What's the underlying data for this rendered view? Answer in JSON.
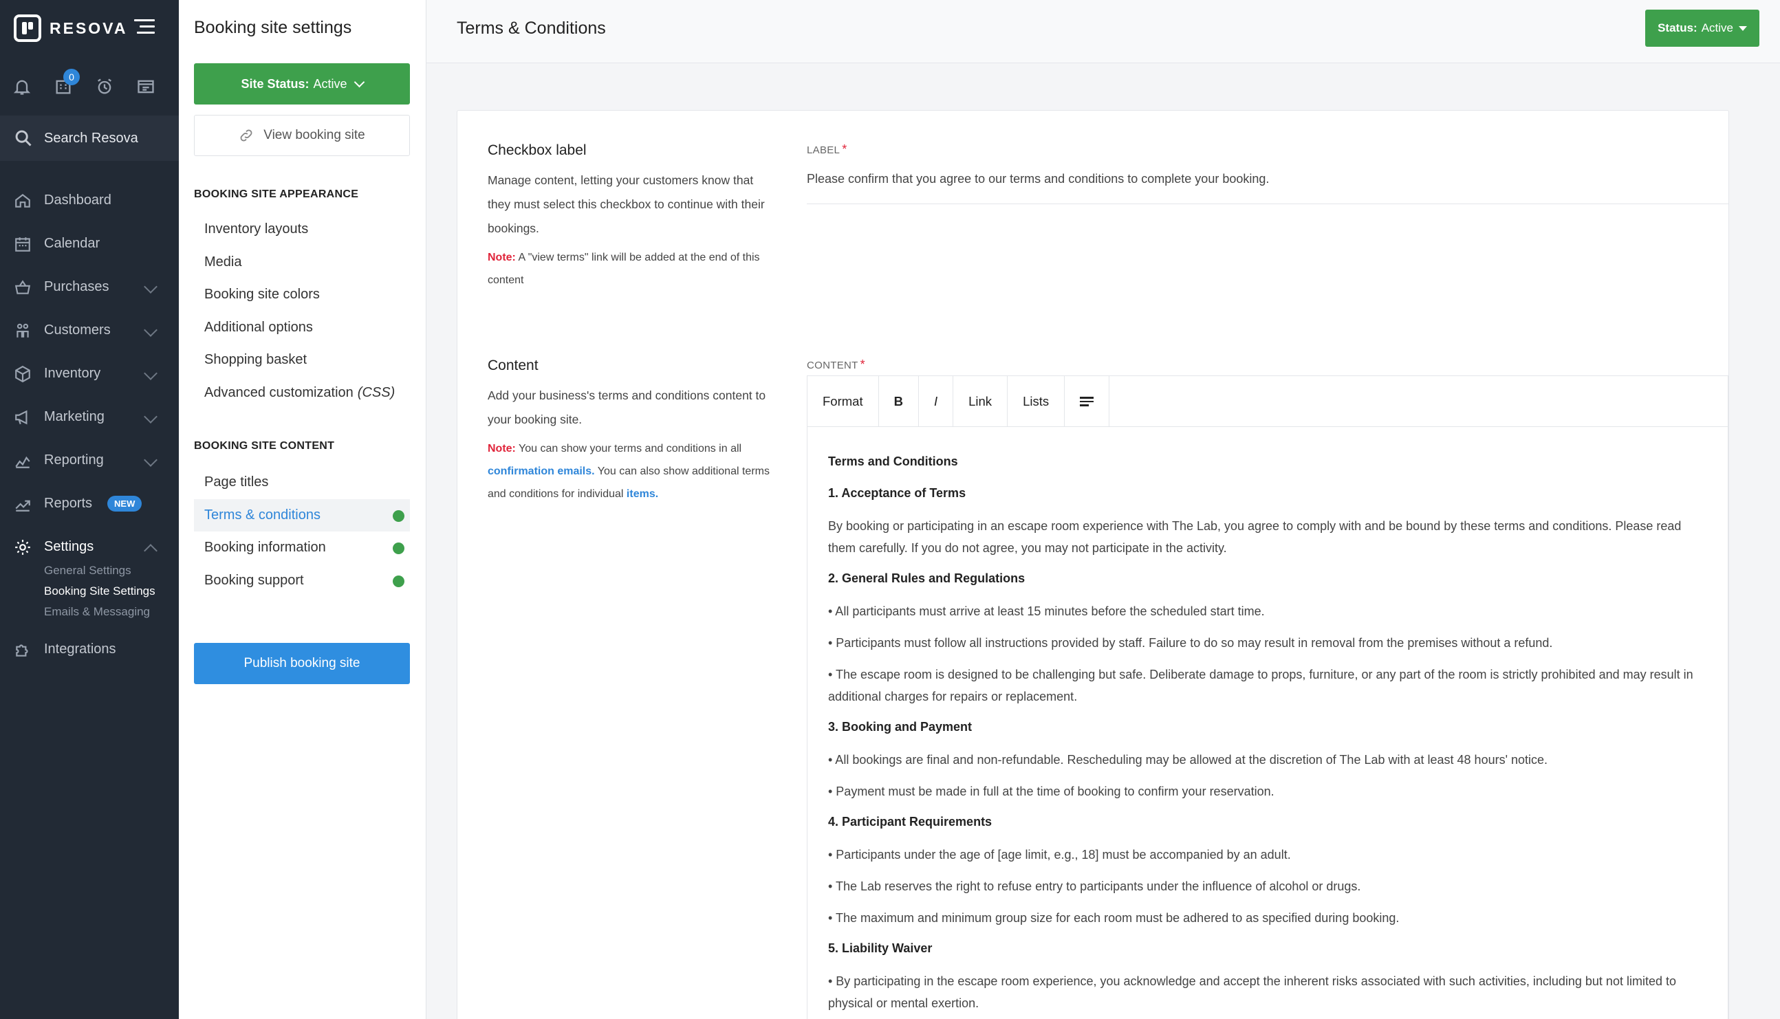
{
  "nav": {
    "brand": "RESOVA",
    "notification_count": "0",
    "search_label": "Search Resova",
    "items": [
      {
        "label": "Dashboard",
        "icon": "home-icon"
      },
      {
        "label": "Calendar",
        "icon": "calendar-icon"
      },
      {
        "label": "Purchases",
        "icon": "basket-icon"
      },
      {
        "label": "Customers",
        "icon": "customers-icon"
      },
      {
        "label": "Inventory",
        "icon": "box-icon"
      },
      {
        "label": "Marketing",
        "icon": "megaphone-icon"
      },
      {
        "label": "Reporting",
        "icon": "line-chart-icon"
      },
      {
        "label": "Reports",
        "icon": "trend-icon",
        "badge": "NEW"
      },
      {
        "label": "Settings",
        "icon": "gear-icon"
      },
      {
        "label": "Integrations",
        "icon": "puzzle-icon"
      }
    ],
    "settings_sub": [
      "General Settings",
      "Booking Site Settings",
      "Emails & Messaging"
    ]
  },
  "settings": {
    "title": "Booking site settings",
    "site_status_prefix": "Site Status:",
    "site_status_value": "Active",
    "view_site": "View booking site",
    "appearance_heading": "BOOKING SITE APPEARANCE",
    "appearance": [
      "Inventory layouts",
      "Media",
      "Booking site colors",
      "Additional options",
      "Shopping basket"
    ],
    "advanced_prefix": "Advanced customization",
    "advanced_suffix": "(CSS)",
    "content_heading": "BOOKING SITE CONTENT",
    "content": [
      "Page titles",
      "Terms & conditions",
      "Booking information",
      "Booking support"
    ],
    "publish": "Publish booking site"
  },
  "main": {
    "title": "Terms & Conditions",
    "status_prefix": "Status:",
    "status_value": "Active",
    "checkbox": {
      "heading": "Checkbox label",
      "desc": "Manage content, letting your customers know that they must select this checkbox to continue with their bookings.",
      "note_label": "Note:",
      "note_text": "A \"view terms\" link will be added at the end of this content",
      "field_label": "LABEL",
      "required": "*",
      "value": "Please confirm that you agree to our terms and conditions to complete your booking."
    },
    "content": {
      "heading": "Content",
      "desc": "Add your business's terms and conditions content to your booking site.",
      "note_label": "Note:",
      "note_a": "You can show your terms and conditions in all",
      "note_link1": "confirmation emails.",
      "note_b": "You can also show additional terms and conditions for individual",
      "note_link2": "items.",
      "field_label": "CONTENT",
      "required": "*"
    },
    "toolbar": [
      "Format",
      "B",
      "I",
      "Link",
      "Lists"
    ],
    "toolbar_align_icon": "align-left-icon",
    "doc": [
      {
        "t": "h",
        "text": "Terms and Conditions"
      },
      {
        "t": "h",
        "text": "1. Acceptance of Terms"
      },
      {
        "t": "p",
        "text": "By booking or participating in an escape room experience with The Lab, you agree to comply with and be bound by these terms and conditions. Please read them carefully. If you do not agree, you may not participate in the activity."
      },
      {
        "t": "h",
        "text": "2. General Rules and Regulations"
      },
      {
        "t": "p",
        "text": "• All participants must arrive at least 15 minutes before the scheduled start time."
      },
      {
        "t": "p",
        "text": "• Participants must follow all instructions provided by staff. Failure to do so may result in removal from the premises without a refund."
      },
      {
        "t": "p",
        "text": "• The escape room is designed to be challenging but safe. Deliberate damage to props, furniture, or any part of the room is strictly prohibited and may result in additional charges for repairs or replacement."
      },
      {
        "t": "h",
        "text": "3. Booking and Payment"
      },
      {
        "t": "p",
        "text": "• All bookings are final and non-refundable. Rescheduling may be allowed at the discretion of The Lab with at least 48 hours' notice."
      },
      {
        "t": "p",
        "text": "• Payment must be made in full at the time of booking to confirm your reservation."
      },
      {
        "t": "h",
        "text": "4. Participant Requirements"
      },
      {
        "t": "p",
        "text": "• Participants under the age of [age limit, e.g., 18] must be accompanied by an adult."
      },
      {
        "t": "p",
        "text": "• The Lab reserves the right to refuse entry to participants under the influence of alcohol or drugs."
      },
      {
        "t": "p",
        "text": "• The maximum and minimum group size for each room must be adhered to as specified during booking."
      },
      {
        "t": "h",
        "text": "5. Liability Waiver"
      },
      {
        "t": "p",
        "text": "• By participating in the escape room experience, you acknowledge and accept the inherent risks associated with such activities, including but not limited to physical or mental exertion."
      }
    ]
  },
  "colors": {
    "nav_bg": "#222a35",
    "green": "#3ea04c",
    "blue": "#2f86d9",
    "red": "#e0253b"
  }
}
